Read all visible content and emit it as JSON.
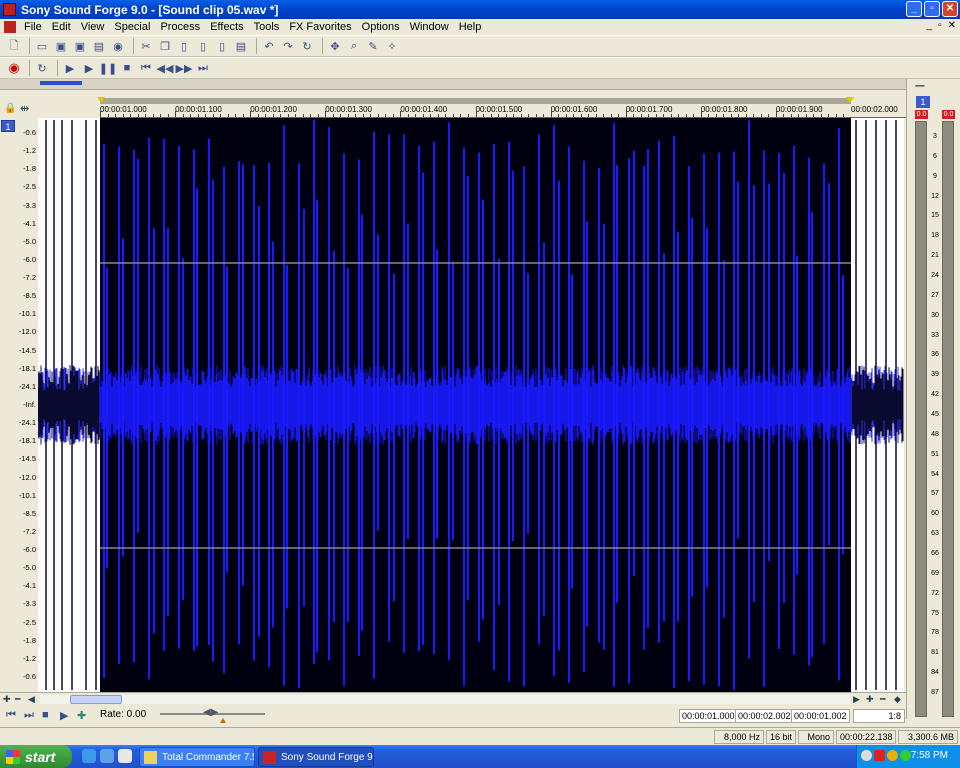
{
  "window": {
    "title": "Sony Sound Forge 9.0 - [Sound clip 05.wav *]"
  },
  "menu": {
    "items": [
      "File",
      "Edit",
      "View",
      "Special",
      "Process",
      "Effects",
      "Tools",
      "FX Favorites",
      "Options",
      "Window",
      "Help"
    ]
  },
  "ruler": {
    "labels": [
      "00:00:01.000",
      "00:00:01.100",
      "00:00:01.200",
      "00:00:01.300",
      "00:00:01.400",
      "00:00:01.500",
      "00:00:01.600",
      "00:00:01.700",
      "00:00:01.800",
      "00:00:01.900",
      "00:00:02.000"
    ]
  },
  "channel": {
    "number": "1"
  },
  "db_scale": [
    "-0.6",
    "-1.2",
    "-1.8",
    "-2.5",
    "-3.3",
    "-4.1",
    "-5.0",
    "-6.0",
    "-7.2",
    "-8.5",
    "-10.1",
    "-12.0",
    "-14.5",
    "-18.1",
    "-24.1",
    "-Inf.",
    "-24.1",
    "-18.1",
    "-14.5",
    "-12.0",
    "-10.1",
    "-8.5",
    "-7.2",
    "-6.0",
    "-5.0",
    "-4.1",
    "-3.3",
    "-2.5",
    "-1.8",
    "-1.2",
    "-0.6"
  ],
  "meters": {
    "channel": "1",
    "peak_left": "0.0",
    "peak_right": "0.0",
    "scale": [
      "3",
      "6",
      "9",
      "12",
      "15",
      "18",
      "21",
      "24",
      "27",
      "30",
      "33",
      "36",
      "39",
      "42",
      "45",
      "48",
      "51",
      "54",
      "57",
      "60",
      "63",
      "66",
      "69",
      "72",
      "75",
      "78",
      "81",
      "84",
      "87"
    ]
  },
  "colors": {
    "waveform": "#1a1aff",
    "selection_bg": "#000010",
    "unselected_bg": "#ffffff",
    "unselected_wave": "#0a0a30",
    "grid": "#888888"
  },
  "transport": {
    "rate_label": "Rate: 0.00",
    "selection_start": "00:00:01.000",
    "selection_end": "00:00:02.002",
    "selection_length": "00:00:01.002",
    "zoom": "1:8"
  },
  "status": {
    "sample_rate": "8,000 Hz",
    "bit_depth": "16 bit",
    "channels": "Mono",
    "length": "00:00:22.138",
    "disk_space": "3,300.6 MB"
  },
  "taskbar": {
    "start_label": "start",
    "tasks": [
      {
        "label": "Total Commander 7.5...",
        "active": false
      },
      {
        "label": "Sony Sound Forge 9....",
        "active": true
      }
    ],
    "clock": "7:58 PM"
  }
}
